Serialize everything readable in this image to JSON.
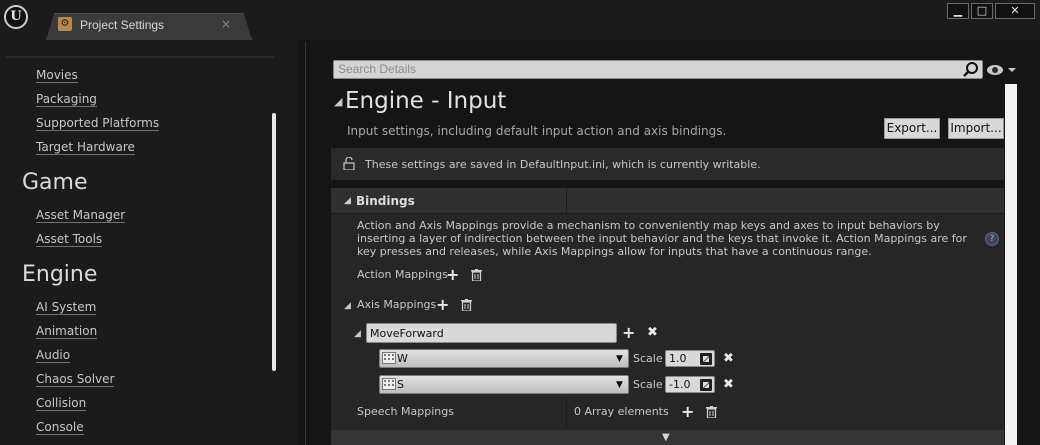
{
  "window": {
    "tab_title": "Project Settings",
    "tab_close": "×",
    "controls": [
      "▁",
      "□",
      "✕"
    ]
  },
  "sidebar": {
    "items_top": [
      "Movies",
      "Packaging",
      "Supported Platforms",
      "Target Hardware"
    ],
    "sections": [
      {
        "title": "Game",
        "items": [
          "Asset Manager",
          "Asset Tools"
        ]
      },
      {
        "title": "Engine",
        "items": [
          "AI System",
          "Animation",
          "Audio",
          "Chaos Solver",
          "Collision",
          "Console"
        ]
      }
    ]
  },
  "search": {
    "placeholder": "Search Details"
  },
  "page": {
    "title": "Engine - Input",
    "description": "Input settings, including default input action and axis bindings.",
    "export_label": "Export...",
    "import_label": "Import...",
    "notice": "These settings are saved in DefaultInput.ini, which is currently writable."
  },
  "bindings": {
    "title": "Bindings",
    "description": "Action and Axis Mappings provide a mechanism to conveniently map keys and axes to input behaviors by inserting a layer of indirection between the input behavior and the keys that invoke it. Action Mappings are for key presses and releases, while Axis Mappings allow for inputs that have a continuous range.",
    "action_mappings_label": "Action Mappings",
    "axis_mappings_label": "Axis Mappings",
    "axis_name": "MoveForward",
    "keys": [
      {
        "key": "W",
        "scale_label": "Scale",
        "scale": "1.0"
      },
      {
        "key": "S",
        "scale_label": "Scale",
        "scale": "-1.0"
      }
    ],
    "speech_mappings_label": "Speech Mappings",
    "speech_value": "0 Array elements"
  },
  "colors": {
    "accent": "#d9d9d9",
    "panel": "#262626",
    "background": "#151515"
  }
}
